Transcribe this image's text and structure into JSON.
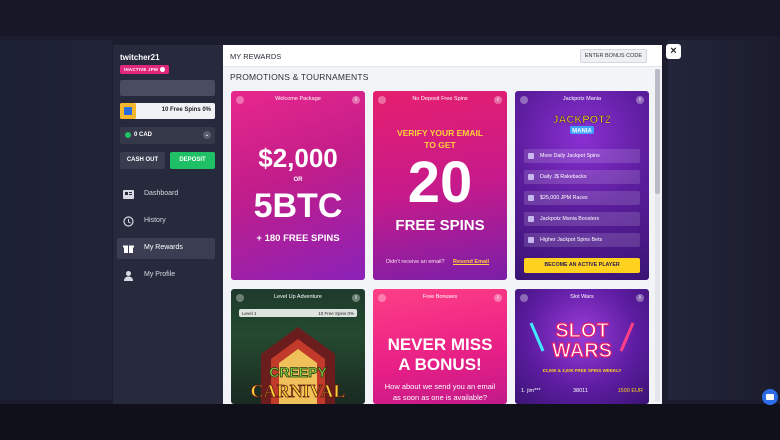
{
  "sidebar": {
    "username": "twitcher21",
    "status_badge": "INACTIVE JPM",
    "free_spins": "10 Free Spins 0%",
    "currency": "0 CAD",
    "cash_out": "CASH OUT",
    "deposit": "DEPOSIT",
    "nav": [
      {
        "label": "Dashboard",
        "icon": "dashboard-icon"
      },
      {
        "label": "History",
        "icon": "history-icon"
      },
      {
        "label": "My Rewards",
        "icon": "gift-icon",
        "active": true
      },
      {
        "label": "My Profile",
        "icon": "user-icon"
      }
    ]
  },
  "header": {
    "title": "MY REWARDS",
    "bonus_code_button": "ENTER BONUS CODE"
  },
  "section_title": "PROMOTIONS & TOURNAMENTS",
  "cards": {
    "welcome": {
      "title": "Welcome Package",
      "amount": "$2,000",
      "or": "OR",
      "btc": "5BTC",
      "extra": "+ 180 FREE SPINS"
    },
    "no_deposit": {
      "title": "No Deposit Free Spins",
      "line1": "VERIFY YOUR EMAIL",
      "line2": "TO GET",
      "number": "20",
      "spins": "FREE SPINS",
      "prompt": "Didn't receive an email?",
      "resend": "Resend Email"
    },
    "jackpotz": {
      "title": "Jackpotz Mania",
      "logo_top": "JACKPOTZ",
      "logo_bottom": "MANIA",
      "features": [
        "More Daily Jackpot Spins",
        "Daily J$ Rakebacks",
        "$25,000 JPM Races",
        "Jackpotz Mania Boosters",
        "Higher Jackpot Spins Bets"
      ],
      "cta": "BECOME AN ACTIVE PLAYER"
    },
    "level_up": {
      "title": "Level Up Adventure",
      "level": "Level 1",
      "progress": "10 Free Spins 0%",
      "game_top": "CREEPY",
      "game_bottom": "CARNIVAL"
    },
    "free_bonuses": {
      "title": "Free Bonuses",
      "headline1": "NEVER MISS",
      "headline2": "A BONUS!",
      "body1": "How about we send you an email",
      "body2": "as soon as one is available?"
    },
    "slot_wars": {
      "title": "Slot Wars",
      "logo_top": "SLOT",
      "logo_bottom": "WARS",
      "tagline": "€3,000 & 3,000 FREE SPINS WEEKLY",
      "rank": "1. jim***",
      "score": "38011",
      "prize": "1500 EUR"
    }
  },
  "colors": {
    "accent_green": "#1fbf65",
    "accent_pink": "#e0277b",
    "accent_yellow": "#ffd21f"
  }
}
